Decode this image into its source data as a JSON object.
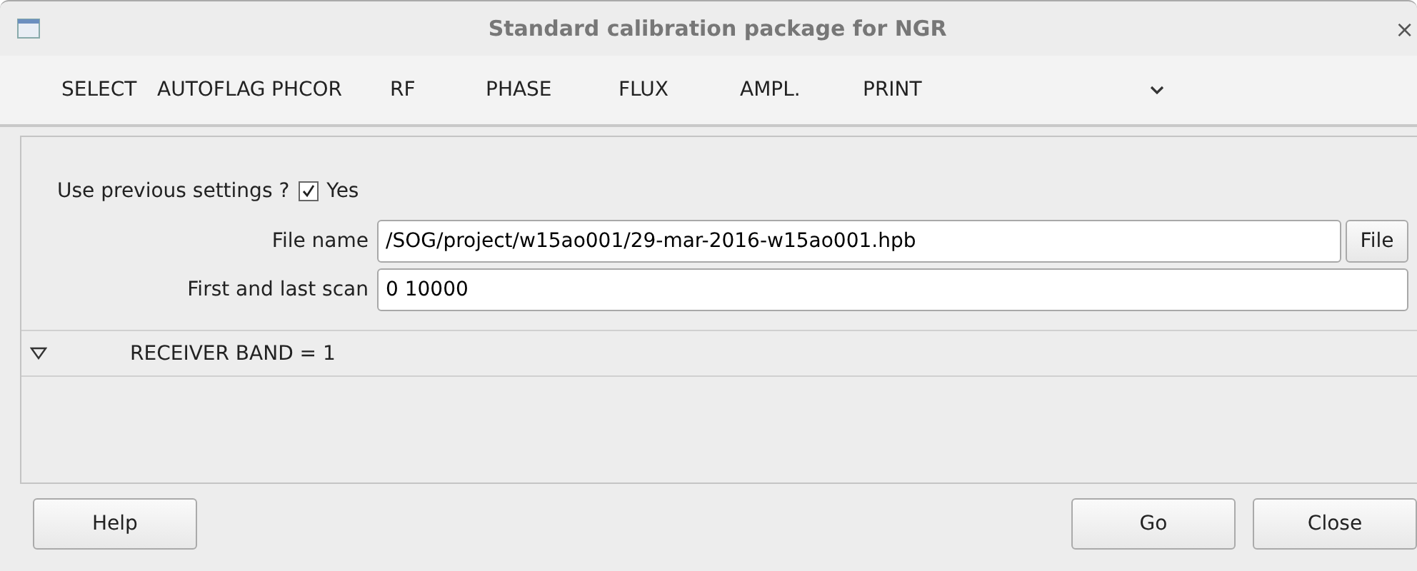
{
  "window": {
    "title": "Standard calibration package for NGR",
    "close": "×"
  },
  "menu": [
    "SELECT",
    "AUTOFLAG",
    "PHCOR",
    "RF",
    "PHASE",
    "FLUX",
    "AMPL.",
    "PRINT"
  ],
  "form": {
    "use_previous": {
      "label": "Use previous settings ?",
      "option": "Yes",
      "checked": true
    },
    "fields": [
      {
        "label": "File name",
        "value": "/SOG/project/w15ao001/29-mar-2016-w15ao001.hpb",
        "button": "File"
      },
      {
        "label": "First and last scan",
        "value": "0 10000"
      }
    ]
  },
  "section": {
    "title": "RECEIVER BAND = 1",
    "expanded": true
  },
  "buttons": {
    "left": [
      "Help"
    ],
    "right": [
      "Go",
      "Close"
    ]
  }
}
